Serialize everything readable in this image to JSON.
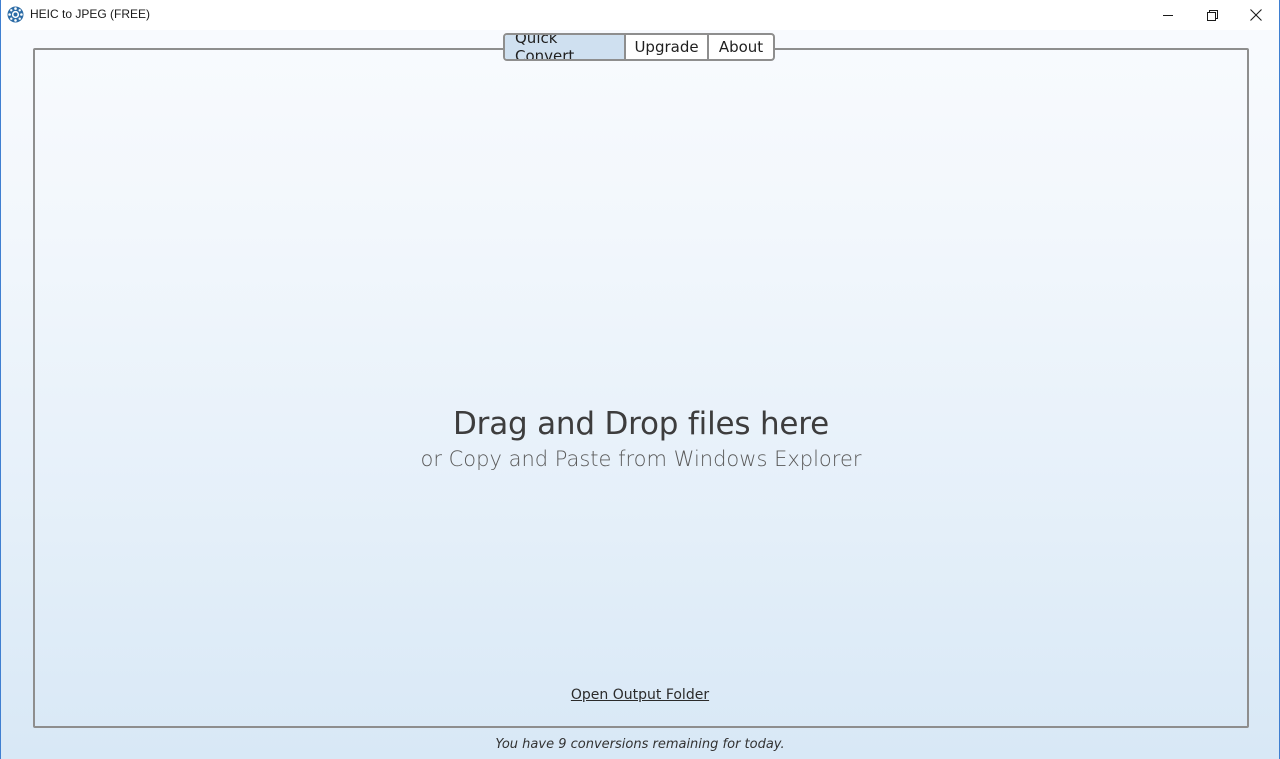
{
  "window": {
    "title": "HEIC to JPEG (FREE)",
    "controls": {
      "minimize_icon": "minimize-icon",
      "maximize_icon": "restore-icon",
      "close_icon": "close-icon"
    }
  },
  "tabs": [
    {
      "label": "Quick Convert",
      "active": true
    },
    {
      "label": "Upgrade",
      "active": false
    },
    {
      "label": "About",
      "active": false
    }
  ],
  "drop_zone": {
    "heading": "Drag and Drop files here",
    "subheading": "or Copy and Paste from Windows Explorer",
    "open_output_label": "Open Output Folder"
  },
  "status": {
    "message": "You have 9 conversions remaining for today."
  },
  "colors": {
    "accent_tab": "#cfe0f0",
    "border": "#8e8e8e",
    "window_border": "#3f7fd1",
    "icon_blue": "#2d6ca6"
  }
}
